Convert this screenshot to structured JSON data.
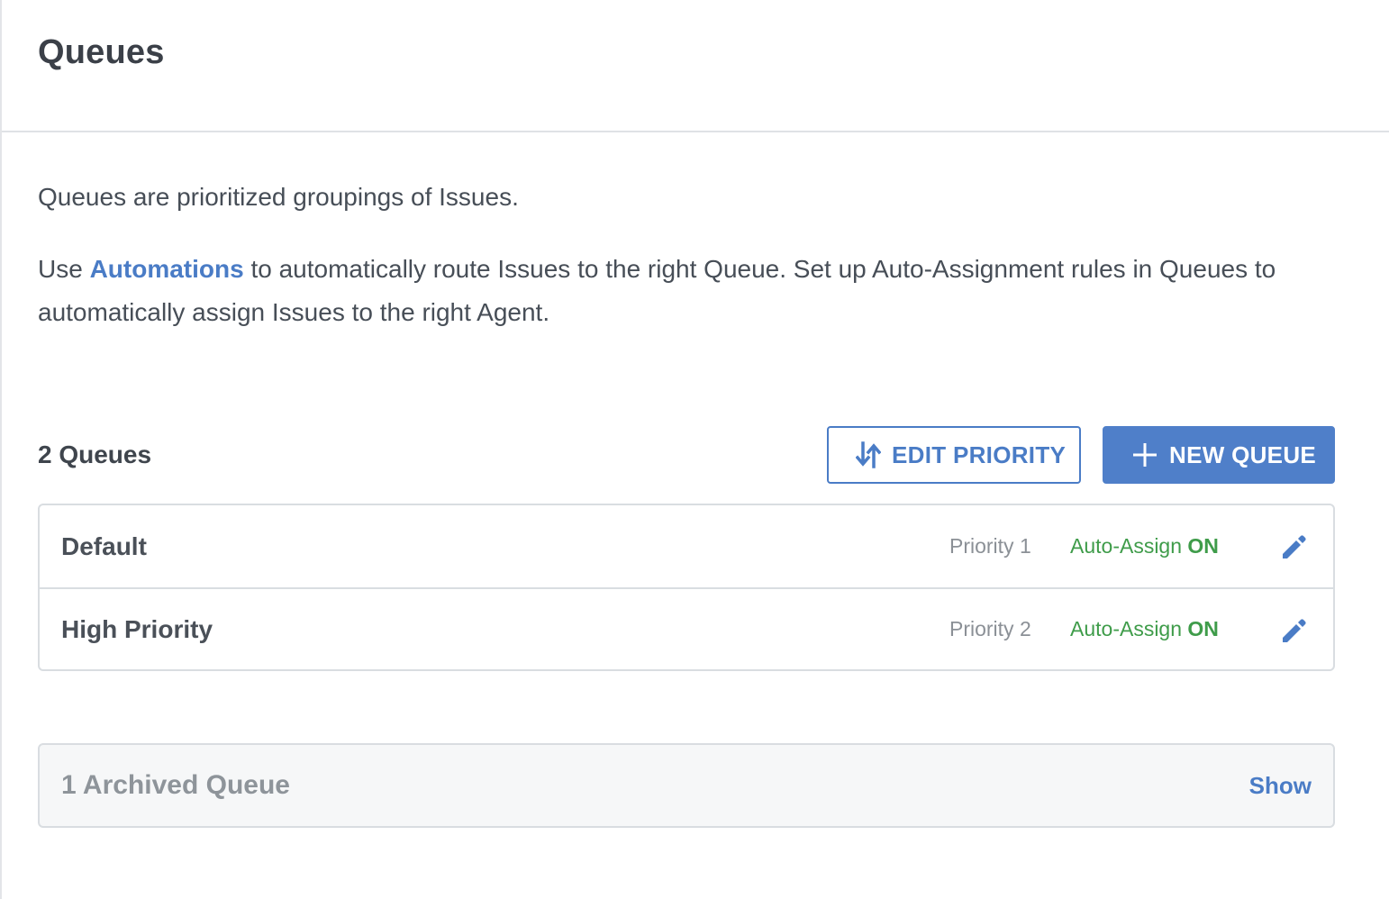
{
  "header": {
    "title": "Queues"
  },
  "description": {
    "line1": "Queues are prioritized groupings of Issues.",
    "line2_prefix": "Use ",
    "line2_link": "Automations",
    "line2_suffix": " to automatically route Issues to the right Queue. Set up Auto-Assignment rules in Queues to automatically assign Issues to the right Agent."
  },
  "toolbar": {
    "count_label": "2 Queues",
    "edit_priority_label": "EDIT PRIORITY",
    "new_queue_label": "NEW QUEUE"
  },
  "queues": [
    {
      "name": "Default",
      "priority": "Priority 1",
      "auto_assign_label": "Auto-Assign",
      "auto_assign_state": "ON"
    },
    {
      "name": "High Priority",
      "priority": "Priority 2",
      "auto_assign_label": "Auto-Assign",
      "auto_assign_state": "ON"
    }
  ],
  "archived": {
    "label": "1 Archived Queue",
    "show_label": "Show"
  },
  "colors": {
    "accent": "#4a7cc6",
    "success": "#3f9c4a"
  },
  "icons": {
    "edit_priority": "sort-arrows-icon",
    "new_queue": "plus-icon",
    "edit_queue": "pencil-icon"
  }
}
